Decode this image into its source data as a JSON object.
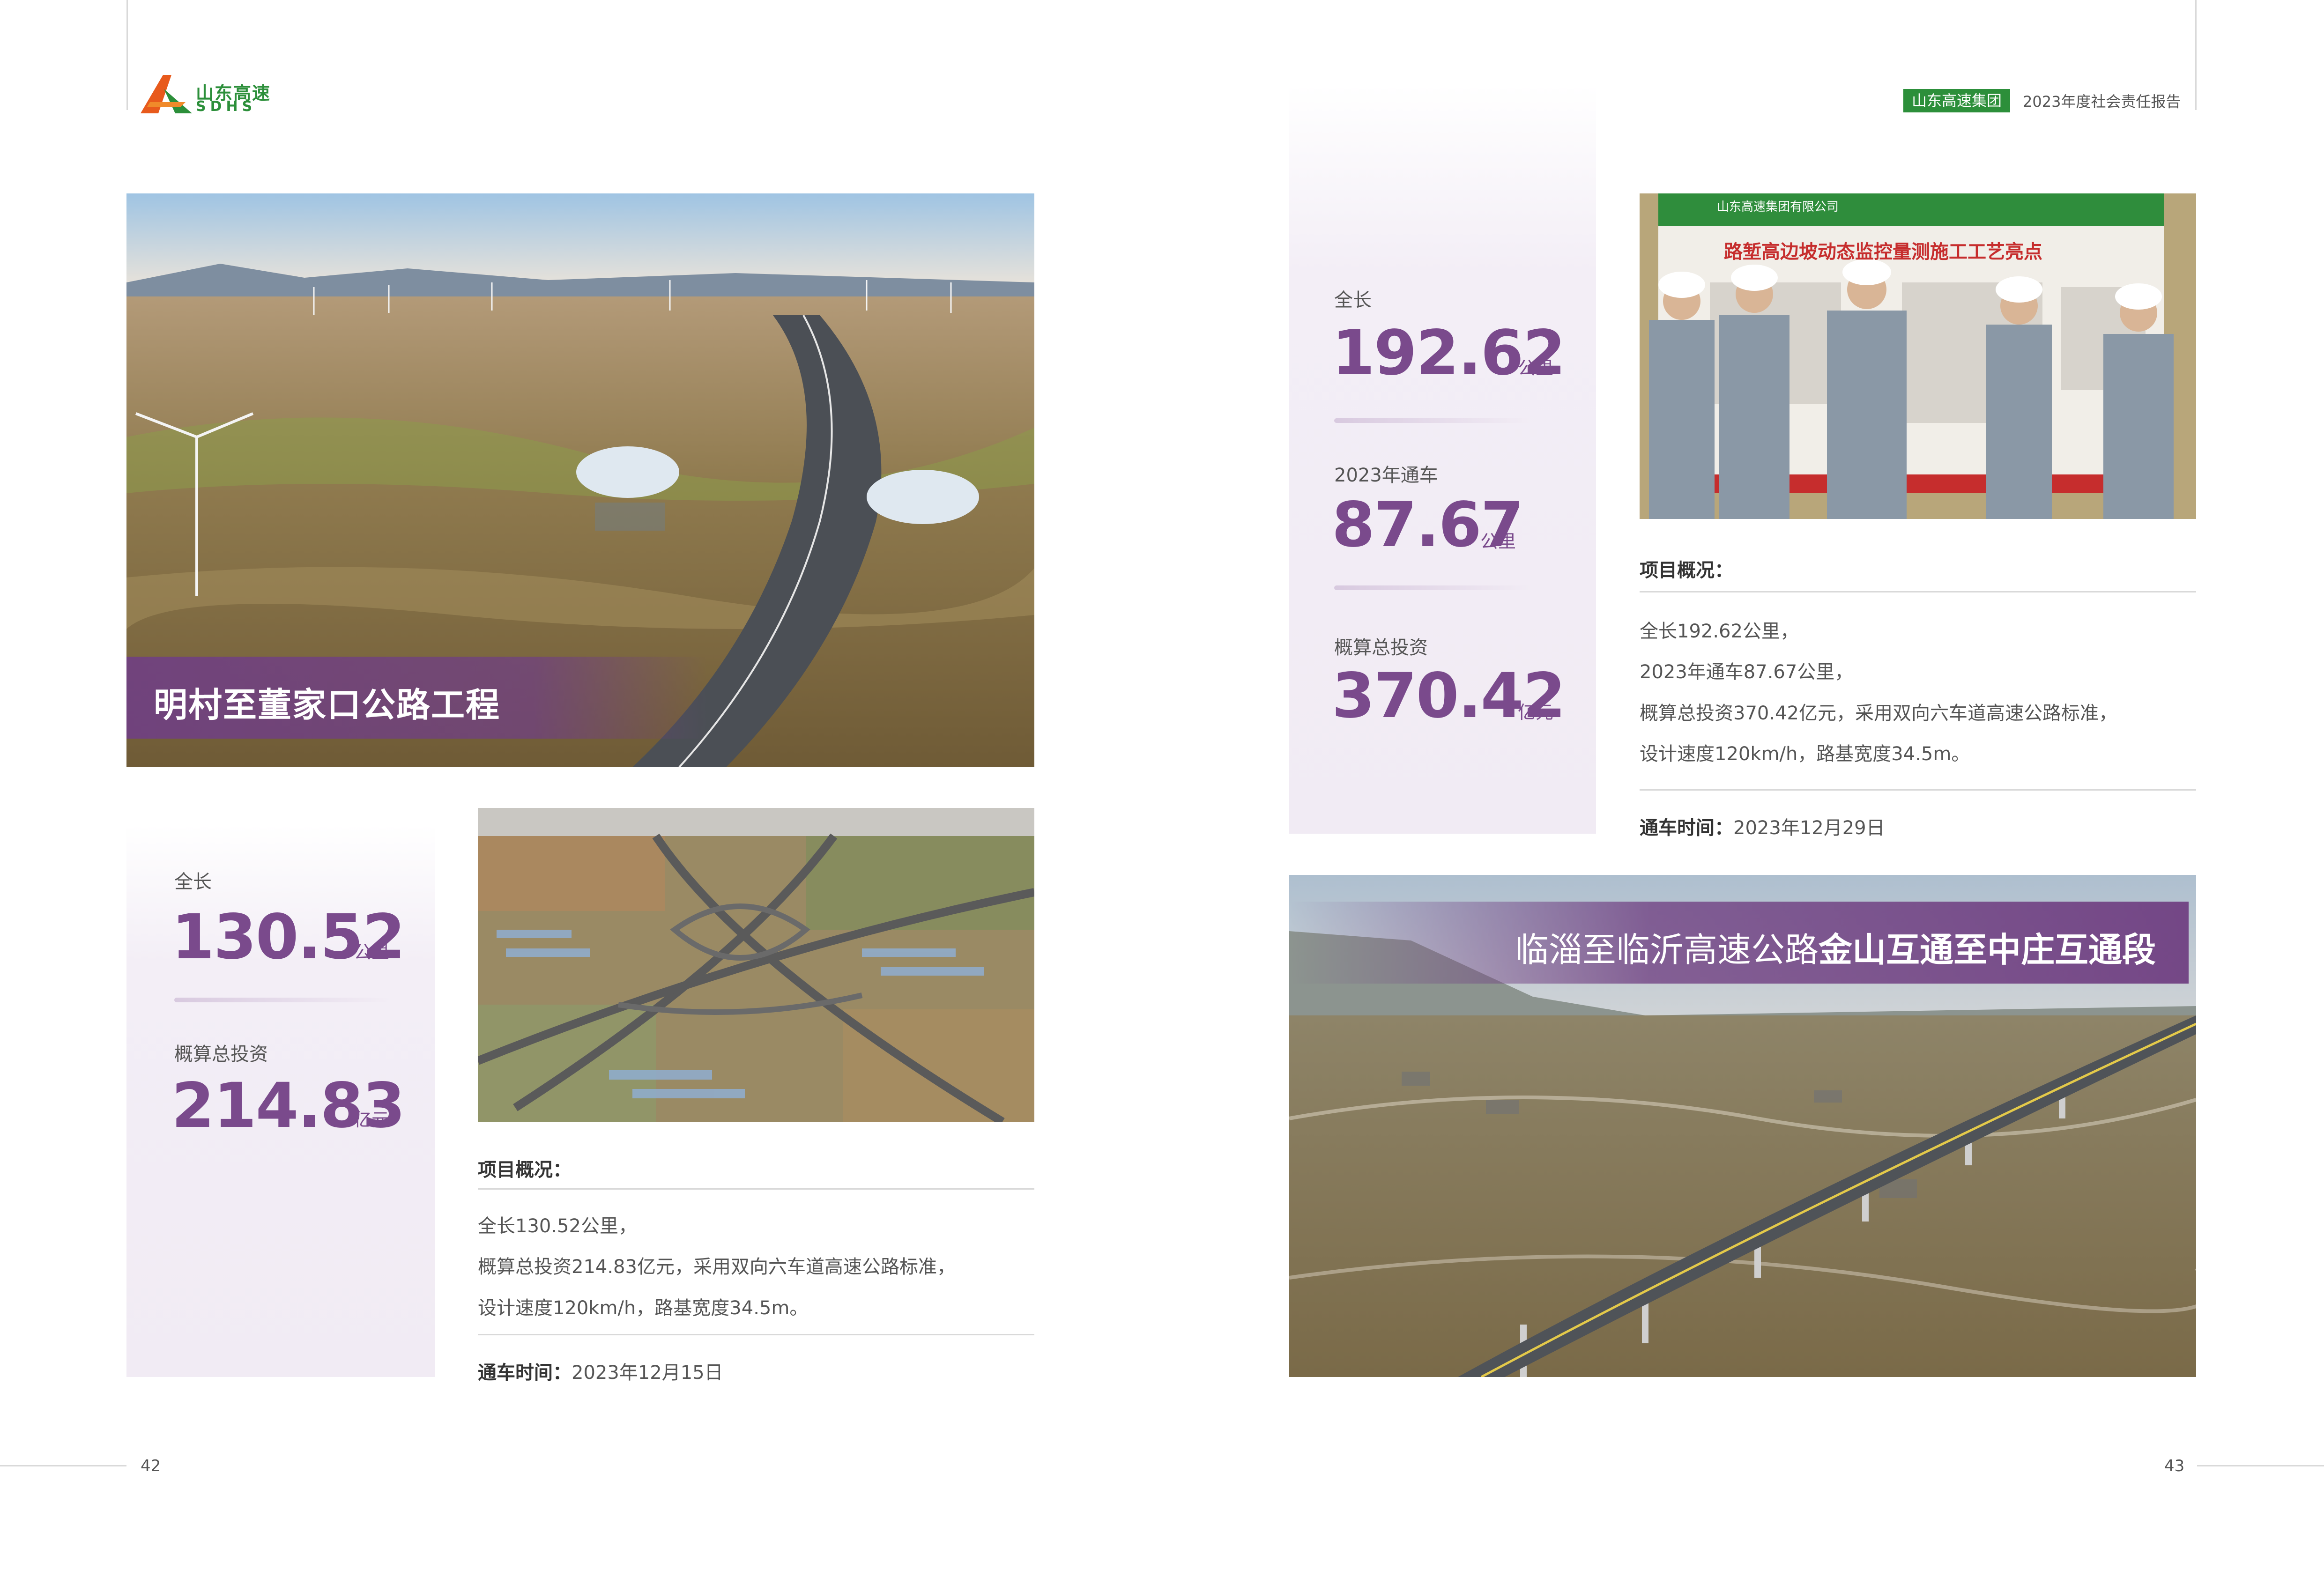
{
  "header": {
    "logo_cn": "山东高速",
    "logo_en": "SDHS",
    "badge": "山东高速集团",
    "report_title": "2023年度社会责任报告"
  },
  "colors": {
    "accent_purple": "#7a4a8c",
    "brand_green": "#2c8f3a"
  },
  "project1": {
    "title": "明村至董家口公路工程",
    "stats": [
      {
        "label": "全长",
        "value": "130.52",
        "unit": "公里"
      },
      {
        "label": "概算总投资",
        "value": "214.83",
        "unit": "亿元"
      }
    ],
    "overview_heading": "项目概况：",
    "overview_lines": [
      "全长130.52公里，",
      "概算总投资214.83亿元，采用双向六车道高速公路标准，",
      "设计速度120km/h，路基宽度34.5m。"
    ],
    "open_label": "通车时间：",
    "open_date": "2023年12月15日"
  },
  "project2": {
    "title_prefix": "临淄至临沂高速公路",
    "title_bold": "金山互通至中庄互通段",
    "stats": [
      {
        "label": "全长",
        "value": "192.62",
        "unit": "公里"
      },
      {
        "label": "2023年通车",
        "value": "87.67",
        "unit": "公里"
      },
      {
        "label": "概算总投资",
        "value": "370.42",
        "unit": "亿元"
      }
    ],
    "overview_heading": "项目概况：",
    "overview_lines": [
      "全长192.62公里，",
      "2023年通车87.67公里，",
      "概算总投资370.42亿元，采用双向六车道高速公路标准，",
      "设计速度120km/h，路基宽度34.5m。"
    ],
    "open_label": "通车时间：",
    "open_date": "2023年12月29日"
  },
  "signboard": {
    "company": "山东高速集团有限公司",
    "title": "路堑高边坡动态监控量测施工工艺亮点"
  },
  "pages": {
    "left": "42",
    "right": "43"
  }
}
